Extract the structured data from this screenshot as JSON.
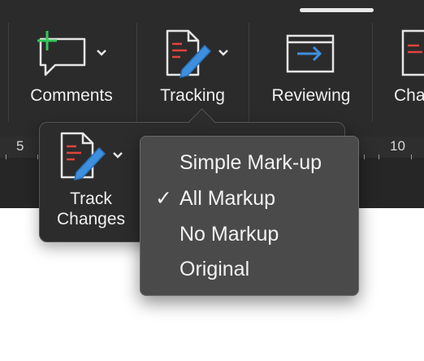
{
  "ribbon": {
    "comments_label": "Comments",
    "tracking_label": "Tracking",
    "reviewing_label": "Reviewing",
    "changes_label": "Cha"
  },
  "ruler": {
    "left_number": "5",
    "right_number": "10"
  },
  "popover": {
    "track_changes_line1": "Track",
    "track_changes_line2": "Changes"
  },
  "markup_menu": {
    "items": [
      {
        "label": "Simple Mark-up",
        "checked": false
      },
      {
        "label": "All Markup",
        "checked": true
      },
      {
        "label": "No Markup",
        "checked": false
      },
      {
        "label": "Original",
        "checked": false
      }
    ],
    "check_glyph": "✓"
  },
  "colors": {
    "accent_green": "#34c759",
    "accent_red": "#e0443e",
    "accent_blue": "#3d8fe0"
  }
}
